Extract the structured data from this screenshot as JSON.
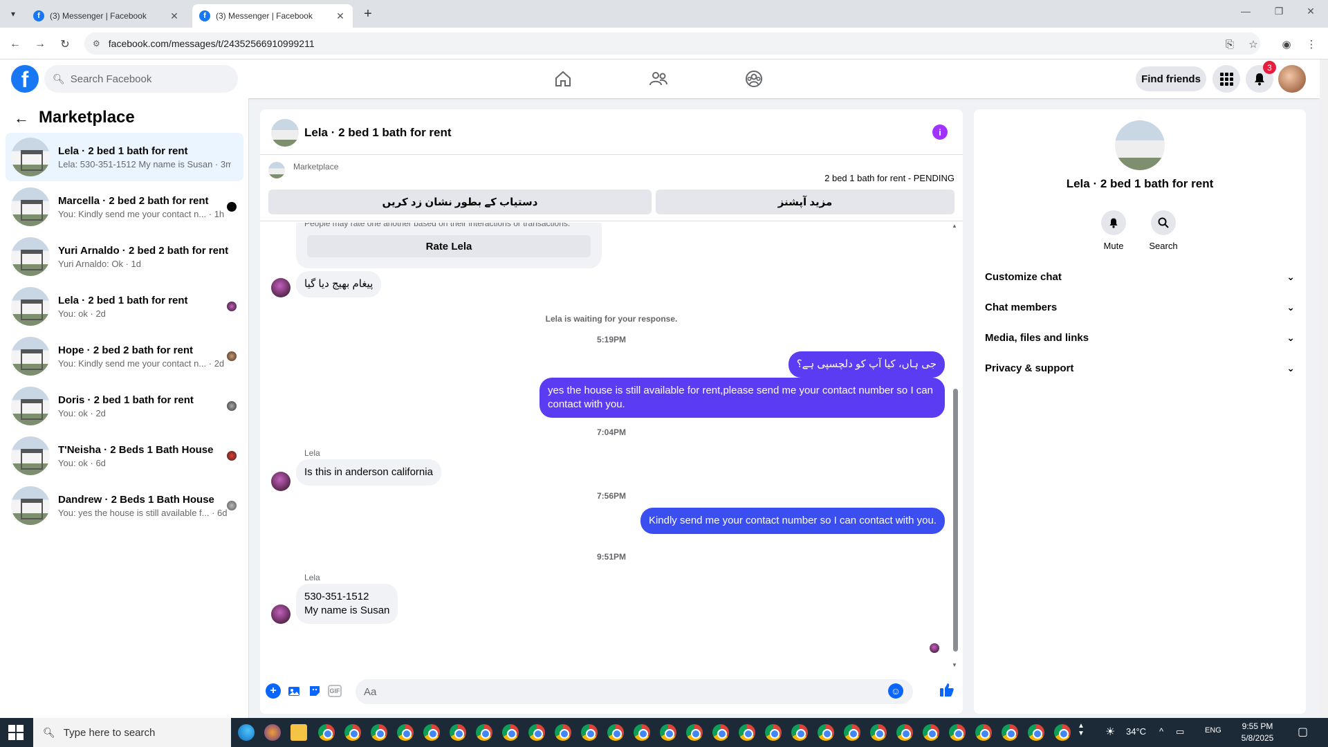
{
  "browser": {
    "tabs": [
      {
        "title": "(3) Messenger | Facebook",
        "active": false
      },
      {
        "title": "(3) Messenger | Facebook",
        "active": true
      }
    ],
    "url": "facebook.com/messages/t/24352566910999211"
  },
  "header": {
    "search_placeholder": "Search Facebook",
    "find_friends": "Find friends",
    "notification_count": "3",
    "brand_color": "#1877f2"
  },
  "sidebar": {
    "title": "Marketplace",
    "conversations": [
      {
        "name": "Lela · 2 bed 1 bath for rent",
        "preview": "Lela: 530-351-1512 My name is Susan · 3m",
        "selected": true
      },
      {
        "name": "Marcella · 2 bed 2 bath for rent",
        "preview": "You: Kindly send me your contact n... · 1h"
      },
      {
        "name": "Yuri Arnaldo · 2 bed 2 bath for rent",
        "preview": "Yuri Arnaldo: Ok · 1d"
      },
      {
        "name": "Lela · 2 bed 1 bath for rent",
        "preview": "You: ok · 2d"
      },
      {
        "name": "Hope · 2 bed 2 bath for rent",
        "preview": "You: Kindly send me your contact n... · 2d"
      },
      {
        "name": "Doris · 2 bed 1 bath for rent",
        "preview": "You: ok · 2d"
      },
      {
        "name": "T'Neisha · 2 Beds 1 Bath House",
        "preview": "You: ok · 6d"
      },
      {
        "name": "Dandrew · 2 Beds 1 Bath House",
        "preview": "You: yes the house is still available f... · 6d"
      }
    ]
  },
  "chat": {
    "title": "Lela · 2 bed 1 bath for rent",
    "marketplace_label": "Marketplace",
    "listing_status": "2 bed 1 bath for rent - PENDING",
    "btn_mark_available": "دستیاب کے بطور نشان زد کریں",
    "btn_more_options": "مزید آپشنز",
    "partial_text": "People may rate one another based on their interactions or transactions.",
    "rate_button": "Rate Lela",
    "messages": {
      "msg1": "پیغام بھیج دیا گیا",
      "waiting": "Lela is waiting for your response.",
      "time1": "5:19PM",
      "msg2": "جی ہاں، کیا آپ کو دلچسپی ہے؟",
      "msg3": "yes the house is still available for rent,please send me your contact number so I can contact with you.",
      "time2": "7:04PM",
      "sender1": "Lela",
      "msg4": "Is this in anderson california",
      "time3": "7:56PM",
      "msg5": "Kindly send me your contact number so I can contact with you.",
      "time4": "9:51PM",
      "sender2": "Lela",
      "msg6_line1": "530-351-1512",
      "msg6_line2": "My name is Susan"
    },
    "composer_placeholder": "Aa",
    "outgoing_color": "#5b3cf2"
  },
  "right_panel": {
    "name": "Lela · 2 bed 1 bath for rent",
    "actions": [
      {
        "label": "Mute"
      },
      {
        "label": "Search"
      }
    ],
    "sections": [
      "Customize chat",
      "Chat members",
      "Media, files and links",
      "Privacy & support"
    ]
  },
  "taskbar": {
    "search_placeholder": "Type here to search",
    "weather": "34°C",
    "language": "ENG",
    "time": "9:55 PM",
    "date": "5/8/2025"
  }
}
